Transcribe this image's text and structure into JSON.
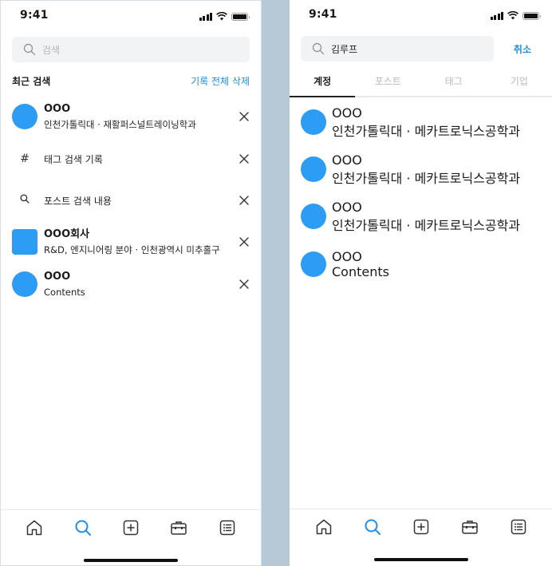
{
  "status": {
    "time": "9:41"
  },
  "left": {
    "search": {
      "placeholder": "검색"
    },
    "recent": {
      "title": "최근 검색",
      "clear_all": "기록 전체 삭제",
      "items": [
        {
          "type": "user",
          "name": "OOO",
          "sub": "인천가톨릭대 · 재활퍼스널트레이닝학과"
        },
        {
          "type": "tag",
          "icon": "#",
          "text": "태그 검색 기록"
        },
        {
          "type": "post",
          "text": "포스트 검색 내용"
        },
        {
          "type": "company",
          "name": "OOO회사",
          "sub": "R&D, 엔지니어링 분야 · 인천광역시 미추홀구"
        },
        {
          "type": "user",
          "name": "OOO",
          "sub": "Contents"
        }
      ]
    }
  },
  "right": {
    "search": {
      "value": "김루프"
    },
    "cancel": "취소",
    "tabs": [
      "계정",
      "포스트",
      "태그",
      "기업"
    ],
    "results": [
      {
        "name": "OOO",
        "sub": "인천가톨릭대 · 메카트로닉스공학과"
      },
      {
        "name": "OOO",
        "sub": "인천가톨릭대 · 메카트로닉스공학과"
      },
      {
        "name": "OOO",
        "sub": "인천가톨릭대 · 메카트로닉스공학과"
      },
      {
        "name": "OOO",
        "sub": "Contents"
      }
    ]
  },
  "tabbar": {
    "items": [
      "home-icon",
      "search-icon",
      "add-icon",
      "briefcase-icon",
      "list-icon"
    ],
    "active": "search-icon"
  },
  "colors": {
    "accent": "#1e8fe6",
    "avatar": "#2d9cf5"
  }
}
